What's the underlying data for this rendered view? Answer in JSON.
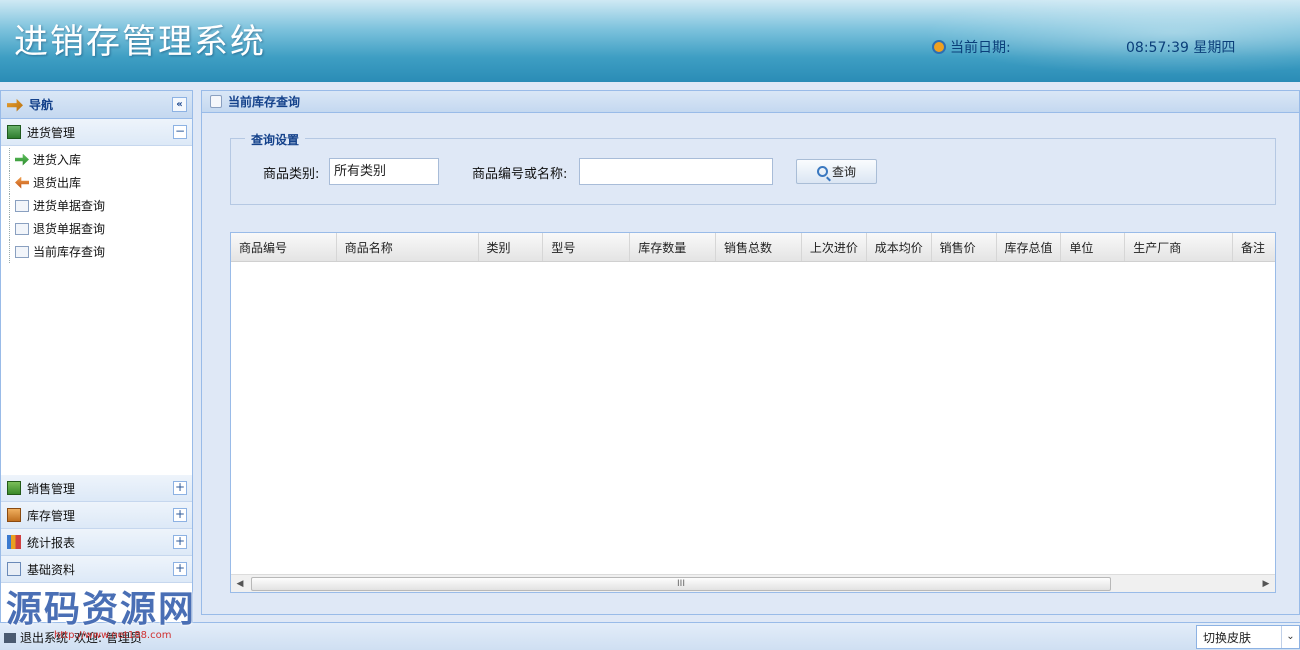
{
  "header": {
    "title": "进销存管理系统",
    "date_label": "当前日期:",
    "time": "08:57:39 星期四"
  },
  "sidebar": {
    "title": "导航",
    "collapse_icon": "«",
    "sections": {
      "purchase": {
        "label": "进货管理",
        "toggle": "−",
        "items": [
          "进货入库",
          "退货出库",
          "进货单据查询",
          "退货单据查询",
          "当前库存查询"
        ]
      },
      "sales": {
        "label": "销售管理",
        "toggle": "+"
      },
      "stock": {
        "label": "库存管理",
        "toggle": "+"
      },
      "stats": {
        "label": "统计报表",
        "toggle": "+"
      },
      "base": {
        "label": "基础资料",
        "toggle": "+"
      }
    }
  },
  "main": {
    "tab_title": "当前库存查询",
    "query": {
      "legend": "查询设置",
      "category_label": "商品类别:",
      "category_value": "所有类别",
      "keyword_label": "商品编号或名称:",
      "keyword_value": "",
      "search_button": "查询"
    },
    "grid": {
      "columns": [
        "商品编号",
        "商品名称",
        "类别",
        "型号",
        "库存数量",
        "销售总数",
        "上次进价",
        "成本均价",
        "销售价",
        "库存总值",
        "单位",
        "生产厂商",
        "备注"
      ],
      "scroll_thumb": "III",
      "scroll_left": "◀",
      "scroll_right": "▶"
    }
  },
  "footer": {
    "exit_label": "退出系统",
    "welcome": "欢迎: 管理员",
    "skin_label": "切换皮肤",
    "skin_arrow": "⌄"
  },
  "watermark": {
    "text": "源码资源网",
    "url": "http://www.net188.com"
  }
}
